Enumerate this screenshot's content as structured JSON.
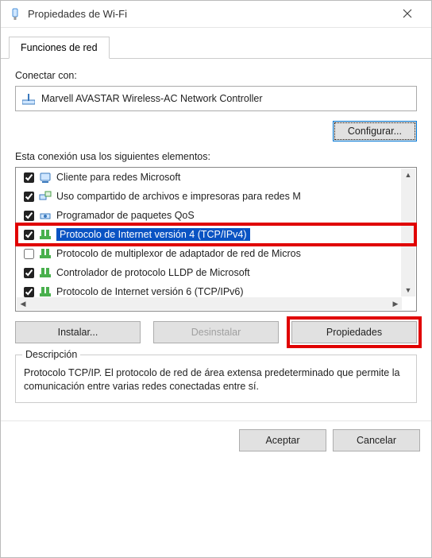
{
  "titlebar": {
    "title": "Propiedades de Wi-Fi"
  },
  "tab": {
    "label": "Funciones de red"
  },
  "connectWith": {
    "label": "Conectar con:"
  },
  "adapter": {
    "name": "Marvell AVASTAR Wireless-AC Network Controller"
  },
  "buttons": {
    "configure": "Configurar...",
    "install": "Instalar...",
    "uninstall": "Desinstalar",
    "properties": "Propiedades",
    "ok": "Aceptar",
    "cancel": "Cancelar"
  },
  "elementsLabel": "Esta conexión usa los siguientes elementos:",
  "items": [
    {
      "checked": true,
      "icon": "client",
      "text": "Cliente para redes Microsoft"
    },
    {
      "checked": true,
      "icon": "share",
      "text": "Uso compartido de archivos e impresoras para redes M"
    },
    {
      "checked": true,
      "icon": "qos",
      "text": "Programador de paquetes QoS"
    },
    {
      "checked": true,
      "icon": "proto",
      "text": "Protocolo de Internet versión 4 (TCP/IPv4)",
      "selected": true
    },
    {
      "checked": false,
      "icon": "mux",
      "text": "Protocolo de multiplexor de adaptador de red de Micros"
    },
    {
      "checked": true,
      "icon": "lldp",
      "text": "Controlador de protocolo LLDP de Microsoft"
    },
    {
      "checked": true,
      "icon": "proto6",
      "text": "Protocolo de Internet versión 6 (TCP/IPv6)"
    }
  ],
  "description": {
    "legend": "Descripción",
    "text": "Protocolo TCP/IP. El protocolo de red de área extensa predeterminado que permite la comunicación entre varias redes conectadas entre sí."
  }
}
